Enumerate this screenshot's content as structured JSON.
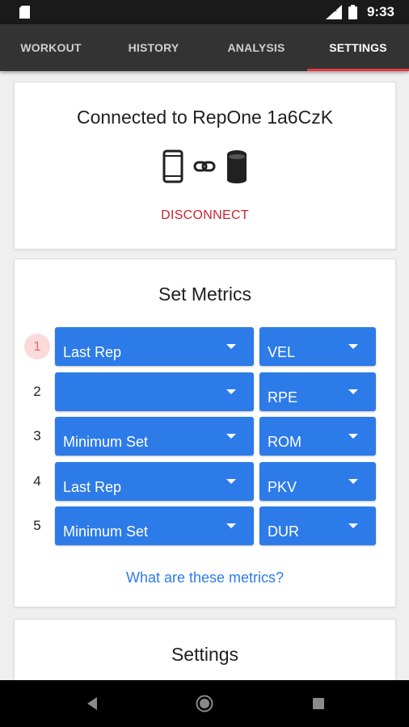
{
  "status_bar": {
    "time": "9:33",
    "network": "LTE",
    "icons": [
      "sd-card-icon",
      "signal-icon",
      "battery-icon"
    ]
  },
  "tabs": [
    {
      "label": "WORKOUT",
      "active": false
    },
    {
      "label": "HISTORY",
      "active": false
    },
    {
      "label": "ANALYSIS",
      "active": false
    },
    {
      "label": "SETTINGS",
      "active": true
    }
  ],
  "connection": {
    "title": "Connected to RepOne 1a6CzK",
    "disconnect_label": "DISCONNECT",
    "icons": [
      "phone-icon",
      "link-icon",
      "sensor-icon"
    ]
  },
  "set_metrics": {
    "title": "Set Metrics",
    "rows": [
      {
        "number": "1",
        "highlighted": true,
        "aggregate": "Last Rep",
        "metric": "VEL"
      },
      {
        "number": "2",
        "highlighted": false,
        "aggregate": "",
        "metric": "RPE"
      },
      {
        "number": "3",
        "highlighted": false,
        "aggregate": "Minimum Set",
        "metric": "ROM"
      },
      {
        "number": "4",
        "highlighted": false,
        "aggregate": "Last Rep",
        "metric": "PKV"
      },
      {
        "number": "5",
        "highlighted": false,
        "aggregate": "Minimum Set",
        "metric": "DUR"
      }
    ],
    "help_link": "What are these metrics?"
  },
  "settings": {
    "title": "Settings"
  },
  "nav_bar": {
    "icons": [
      "back-icon",
      "home-icon",
      "recents-icon"
    ]
  },
  "colors": {
    "accent_blue": "#2d7be8",
    "tab_bar": "#333333",
    "active_tab_underline": "#e0393e",
    "disconnect_red": "#d0202e"
  }
}
